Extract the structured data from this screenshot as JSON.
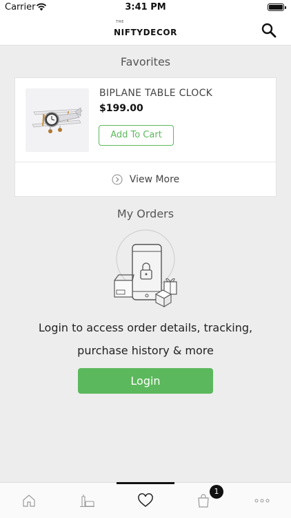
{
  "status_bar": {
    "carrier": "Carrier",
    "time": "3:41 PM"
  },
  "header": {
    "brand_prefix": "THE",
    "brand_name": "NIFTYDECOR",
    "search_icon": "search-icon"
  },
  "favorites": {
    "title": "Favorites",
    "product": {
      "name": "BIPLANE TABLE CLOCK",
      "price": "$199.00",
      "add_to_cart_label": "Add To Cart"
    },
    "view_more_label": "View More"
  },
  "orders": {
    "title": "My Orders",
    "login_message": "Login to access order details, tracking, purchase history & more",
    "login_button": "Login"
  },
  "tab_bar": {
    "tabs": [
      {
        "icon": "home-icon"
      },
      {
        "icon": "room-icon"
      },
      {
        "icon": "heart-icon",
        "active": true
      },
      {
        "icon": "shopping-bag-icon",
        "badge": "1"
      },
      {
        "icon": "more-icon"
      }
    ]
  },
  "colors": {
    "accent_green": "#5cb85c",
    "background": "#ededed"
  }
}
